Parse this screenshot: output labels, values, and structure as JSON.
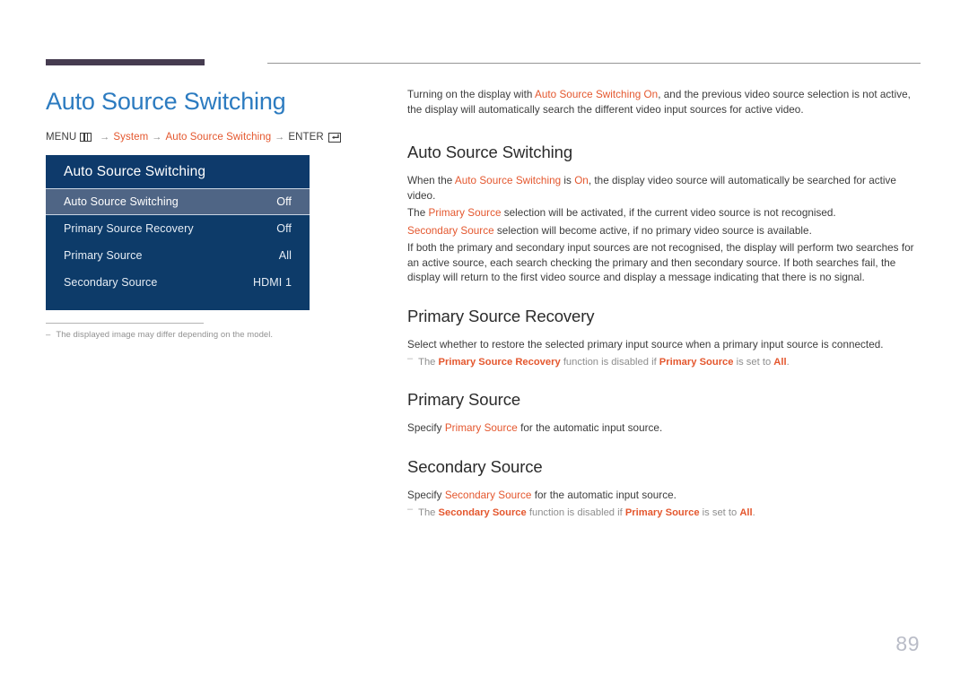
{
  "header": {
    "accent_bar_color": "#463c50",
    "rule_color": "#969696"
  },
  "left": {
    "page_title": "Auto Source Switching",
    "breadcrumb": {
      "menu_label": "MENU",
      "menu_icon": "menu-grid-icon",
      "arrow": "→",
      "item_system": "System",
      "item_feature": "Auto Source Switching",
      "enter_label": "ENTER",
      "enter_icon": "enter-key-icon",
      "accent_color": "#e4572e"
    },
    "osd": {
      "title": "Auto Source Switching",
      "rows": [
        {
          "label": "Auto Source Switching",
          "value": "Off",
          "selected": true
        },
        {
          "label": "Primary Source Recovery",
          "value": "Off",
          "selected": false
        },
        {
          "label": "Primary Source",
          "value": "All",
          "selected": false
        },
        {
          "label": "Secondary Source",
          "value": "HDMI 1",
          "selected": false
        }
      ],
      "background_color": "#0d3b69",
      "selected_color": "#4f6585"
    },
    "note": {
      "dash": "–",
      "text": "The displayed image may differ depending on the model."
    }
  },
  "right": {
    "intro": {
      "p1_a": "Turning on the display with ",
      "p1_accent": "Auto Source Switching On",
      "p1_b": ", and the previous video source selection is not active, the display will automatically search the different video input sources for active video."
    },
    "sections": [
      {
        "heading": "Auto Source Switching",
        "p1_a": "When the ",
        "p1_accent1": "Auto Source Switching",
        "p1_b": " is ",
        "p1_accent2": "On",
        "p1_c": ", the display video source will automatically be searched for active video.",
        "p2_a": "The ",
        "p2_accent": "Primary Source",
        "p2_b": " selection will be activated, if the current video source is not recognised.",
        "p3_accent": "Secondary Source",
        "p3_b": " selection will become active, if no primary video source is available.",
        "p4": "If both the primary and secondary input sources are not recognised, the display will perform two searches for an active source, each search checking the primary and then secondary source. If both searches fail, the display will return to the first video source and display a message indicating that there is no signal."
      },
      {
        "heading": "Primary Source Recovery",
        "p1": "Select whether to restore the selected primary input source when a primary input source is connected.",
        "note_dash": "–",
        "note_a": "The ",
        "note_accent1": "Primary Source Recovery",
        "note_b": " function is disabled if ",
        "note_accent2": "Primary Source",
        "note_c": " is set to ",
        "note_accent3": "All",
        "note_d": "."
      },
      {
        "heading": "Primary Source",
        "p1_a": "Specify ",
        "p1_accent": "Primary Source",
        "p1_b": " for the automatic input source."
      },
      {
        "heading": "Secondary Source",
        "p1_a": "Specify ",
        "p1_accent": "Secondary Source",
        "p1_b": " for the automatic input source.",
        "note_dash": "–",
        "note_a": "The ",
        "note_accent1": "Secondary Source",
        "note_b": " function is disabled if ",
        "note_accent2": "Primary Source",
        "note_c": " is set to ",
        "note_accent3": "All",
        "note_d": "."
      }
    ]
  },
  "page_number": "89"
}
